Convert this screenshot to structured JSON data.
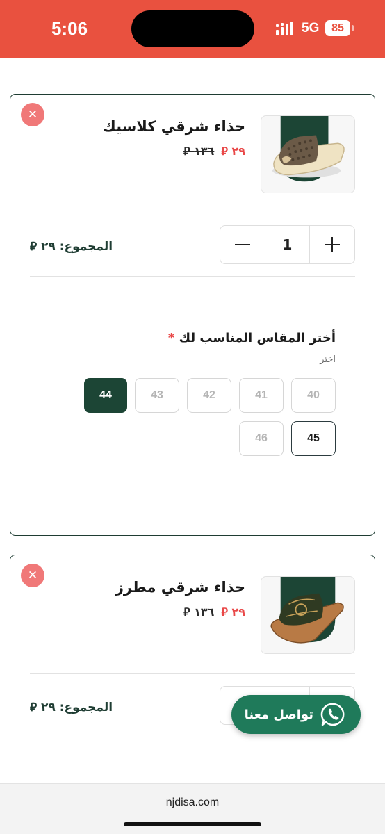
{
  "status": {
    "time": "5:06",
    "network": "5G",
    "battery": "85"
  },
  "currency_symbol": "⃁",
  "items": [
    {
      "title": "حذاء شرقي كلاسيك",
      "old_price": "١٣٦",
      "new_price": "٢٩",
      "quantity": "1",
      "total_label": "المجموع:",
      "total_value": "٢٩",
      "size_label": "أختر المقاس المناسب لك",
      "size_required_mark": "*",
      "size_hint": "اختر",
      "sizes": [
        "40",
        "41",
        "42",
        "43",
        "44",
        "45",
        "46"
      ],
      "selected_size": "44",
      "highlighted_size": "45",
      "thumb_colors": {
        "band": "#1c4535",
        "sole": "#efe3c3",
        "strap": "#6b5a47"
      }
    },
    {
      "title": "حذاء شرقي مطرز",
      "old_price": "١٣٦",
      "new_price": "٢٩",
      "total_label": "المجموع:",
      "total_value": "٢٩",
      "thumb_colors": {
        "band": "#1c4535",
        "sole": "#b87a45",
        "strap": "#2f3a22"
      }
    }
  ],
  "whatsapp": {
    "label": "تواصل معنا"
  },
  "browser": {
    "url": "njdisa.com"
  },
  "colors": {
    "accent": "#1c4535",
    "status_bar": "#e9513f",
    "sale": "#e94848",
    "whatsapp": "#1f7a5a"
  }
}
